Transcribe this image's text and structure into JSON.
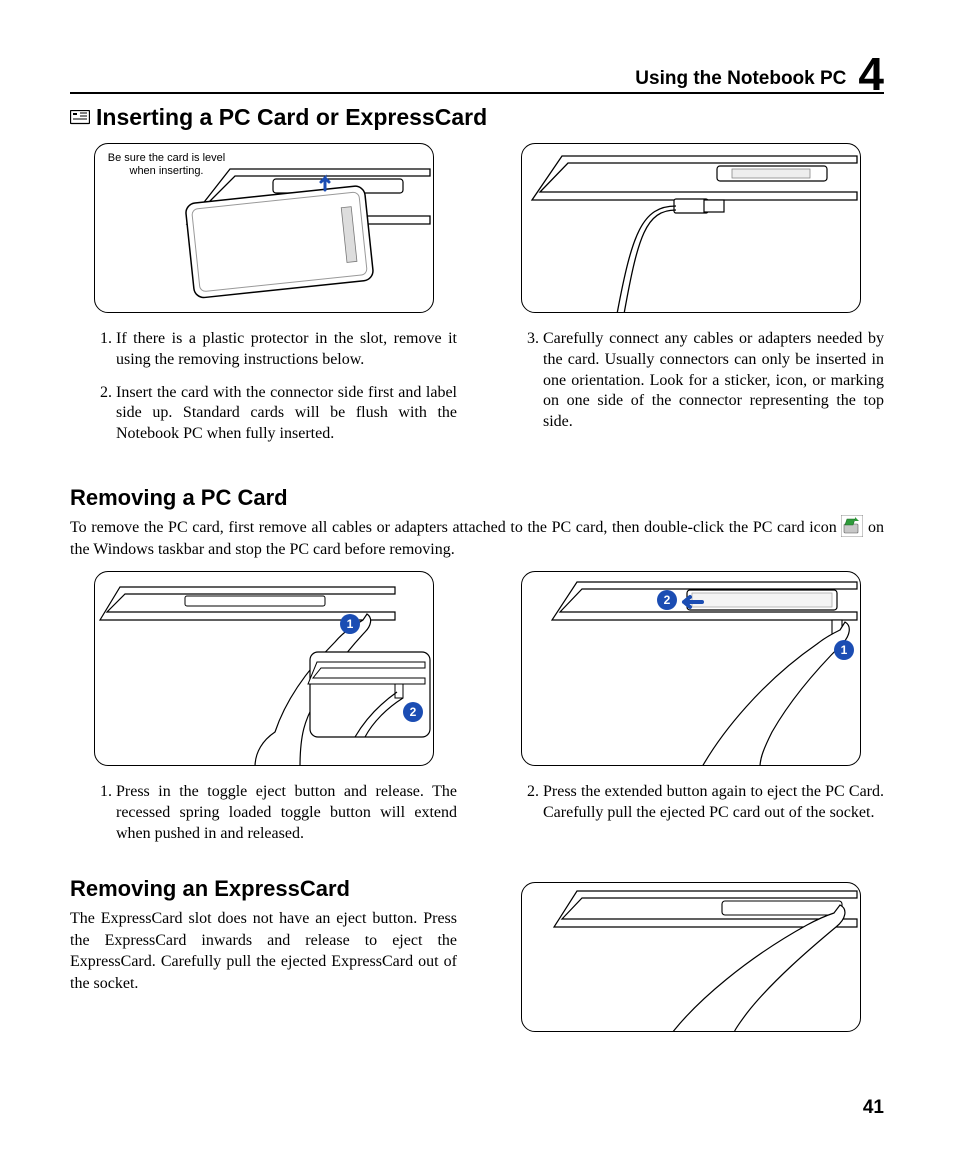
{
  "header": {
    "title": "Using the Notebook PC",
    "chapter": "4"
  },
  "section1": {
    "heading": "Inserting a PC Card or ExpressCard",
    "figure_note": "Be sure the card is level when inserting.",
    "steps_left": [
      "If there is a plastic protector in the slot, remove it using the removing instructions below.",
      "Insert the card with the connector side first and label side up. Standard cards will be flush with the Notebook PC when fully inserted."
    ],
    "steps_right_start": 3,
    "steps_right": [
      "Carefully connect any cables or adapters needed by the card. Usually connectors can only be inserted in one orientation. Look for a sticker, icon, or marking on one side of the connector representing the top side."
    ]
  },
  "section2": {
    "heading": "Removing a PC Card",
    "intro_a": "To remove the PC card, first remove all cables or adapters attached to the PC card, then double-click the PC card icon ",
    "intro_b": " on the Windows taskbar and stop the PC card before removing.",
    "steps_left": [
      "Press in the toggle eject button and release. The recessed spring loaded toggle button will extend when pushed in and released."
    ],
    "steps_right_start": 2,
    "steps_right": [
      "Press the extended button again to eject the PC Card. Carefully pull the ejected PC card out of the socket."
    ]
  },
  "section3": {
    "heading": "Removing an ExpressCard",
    "body": "The ExpressCard slot does not have an eject button. Press the ExpressCard inwards and release to eject the ExpressCard. Carefully pull the ejected ExpressCard out of the socket."
  },
  "page_number": "41"
}
